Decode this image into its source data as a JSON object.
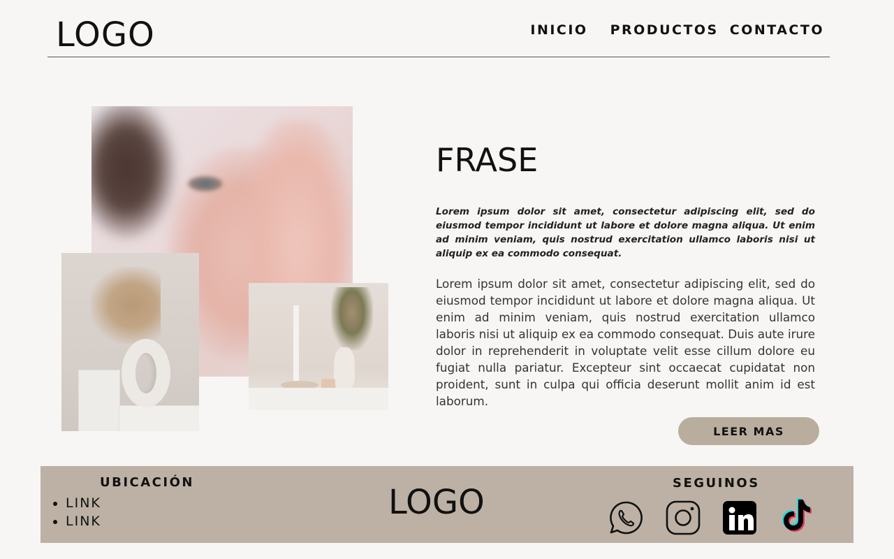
{
  "header": {
    "logo": "LOGO",
    "nav": [
      "INICIO",
      "PRODUCTOS",
      "CONTACTO"
    ]
  },
  "main": {
    "title": "FRASE",
    "intro_bold": "Lorem ipsum dolor sit amet, consectetur adipiscing elit, sed do eiusmod tempor incididunt ut labore et dolore magna aliqua. Ut enim ad minim veniam, quis nostrud exercitation ullamco laboris nisi ut aliquip ex ea commodo consequat.",
    "body": "Lorem ipsum dolor sit amet, consectetur adipiscing elit, sed do eiusmod tempor incididunt ut labore et dolore magna aliqua. Ut enim ad minim veniam, quis nostrud exercitation ullamco laboris nisi ut aliquip ex ea commodo consequat. Duis aute irure dolor in reprehenderit in voluptate velit esse cillum dolore eu fugiat nulla pariatur. Excepteur sint occaecat cupidatat non proident, sunt in culpa qui officia deserunt mollit anim id est laborum.",
    "button_label": "LEER MAS"
  },
  "footer": {
    "location_title": "UBICACIÓN",
    "links": [
      "LINK",
      "LINK"
    ],
    "logo": "LOGO",
    "social_title": "SEGUINOS",
    "social_icons": [
      "whatsapp-icon",
      "instagram-icon",
      "linkedin-icon",
      "tiktok-icon"
    ]
  },
  "colors": {
    "background": "#f7f6f4",
    "accent": "#b9ae9e",
    "footer": "#bcb1a4",
    "text": "#111111"
  }
}
